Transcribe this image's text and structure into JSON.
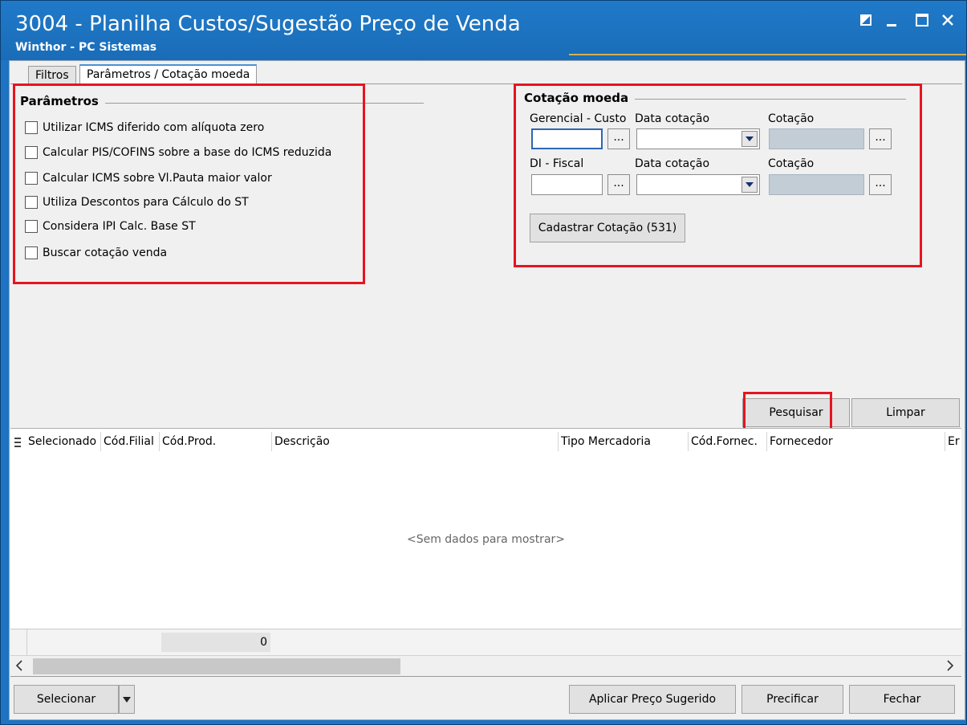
{
  "window": {
    "title": "3004 - Planilha Custos/Sugestão Preço de Venda",
    "subtitle": "Winthor - PC Sistemas"
  },
  "tabs": [
    {
      "label": "Filtros",
      "active": false
    },
    {
      "label": "Parâmetros / Cotação moeda",
      "active": true
    }
  ],
  "parametros": {
    "title": "Parâmetros",
    "options": [
      {
        "label": "Utilizar ICMS diferido com alíquota zero",
        "checked": false
      },
      {
        "label": "Calcular PIS/COFINS sobre a base do ICMS reduzida",
        "checked": false
      },
      {
        "label": "Calcular ICMS sobre Vl.Pauta maior valor",
        "checked": false
      },
      {
        "label": "Utiliza Descontos para Cálculo do ST",
        "checked": false
      },
      {
        "label": "Considera IPI Calc. Base ST",
        "checked": false
      },
      {
        "label": "Buscar cotação venda",
        "checked": false
      }
    ]
  },
  "cotacao": {
    "title": "Cotação moeda",
    "row1": {
      "label1": "Gerencial - Custo",
      "label2": "Data cotação",
      "label3": "Cotação"
    },
    "row2": {
      "label1": "DI - Fiscal",
      "label2": "Data cotação",
      "label3": "Cotação"
    },
    "dots": "...",
    "cadastrar_button": "Cadastrar Cotação (531)"
  },
  "actions": {
    "pesquisar": "Pesquisar",
    "limpar": "Limpar"
  },
  "grid": {
    "columns": [
      "Selecionado",
      "Cód.Filial",
      "Cód.Prod.",
      "Descrição",
      "Tipo Mercadoria",
      "Cód.Fornec.",
      "Fornecedor",
      "Er"
    ],
    "empty_text": "<Sem dados para mostrar>",
    "summary_value": "0"
  },
  "footer": {
    "selecionar": "Selecionar",
    "aplicar": "Aplicar Preço Sugerido",
    "precificar": "Precificar",
    "fechar": "Fechar"
  },
  "colors": {
    "titlebar": "#1e73c3",
    "highlight": "#e8131f"
  }
}
